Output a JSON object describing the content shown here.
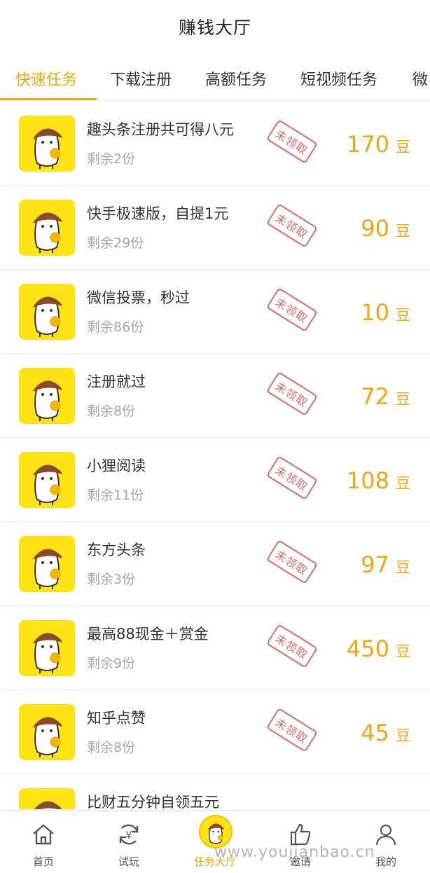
{
  "header": {
    "title": "赚钱大厅"
  },
  "tabs": [
    {
      "label": "快速任务",
      "active": true
    },
    {
      "label": "下载注册",
      "active": false
    },
    {
      "label": "高额任务",
      "active": false
    },
    {
      "label": "短视频任务",
      "active": false
    },
    {
      "label": "微",
      "active": false
    }
  ],
  "tasks": [
    {
      "title": "趣头条注册共可得八元",
      "remaining": "剩余2份",
      "status": "未领取",
      "reward": "170",
      "unit": "豆"
    },
    {
      "title": "快手极速版，自提1元",
      "remaining": "剩余29份",
      "status": "未领取",
      "reward": "90",
      "unit": "豆"
    },
    {
      "title": "微信投票，秒过",
      "remaining": "剩余86份",
      "status": "未领取",
      "reward": "10",
      "unit": "豆"
    },
    {
      "title": "注册就过",
      "remaining": "剩余8份",
      "status": "未领取",
      "reward": "72",
      "unit": "豆"
    },
    {
      "title": "小狸阅读",
      "remaining": "剩余11份",
      "status": "未领取",
      "reward": "108",
      "unit": "豆"
    },
    {
      "title": "东方头条",
      "remaining": "剩余3份",
      "status": "未领取",
      "reward": "97",
      "unit": "豆"
    },
    {
      "title": "最高88现金＋赏金",
      "remaining": "剩余9份",
      "status": "未领取",
      "reward": "450",
      "unit": "豆"
    },
    {
      "title": "知乎点赞",
      "remaining": "剩余8份",
      "status": "未领取",
      "reward": "45",
      "unit": "豆"
    }
  ],
  "partial_task": {
    "title": "比财五分钟自领五元"
  },
  "bottom_nav": [
    {
      "label": "首页",
      "icon": "home-icon",
      "active": false
    },
    {
      "label": "试玩",
      "icon": "yuan-refresh-icon",
      "active": false
    },
    {
      "label": "任务大厅",
      "icon": "mascot-icon",
      "active": true
    },
    {
      "label": "邀请",
      "icon": "thumbs-up-icon",
      "active": false
    },
    {
      "label": "我的",
      "icon": "user-icon",
      "active": false
    }
  ],
  "watermark": "www.youjianbao.cn",
  "colors": {
    "accent": "#f2a516",
    "thumb_bg": "#ffe315",
    "stamp": "#d9534f"
  }
}
